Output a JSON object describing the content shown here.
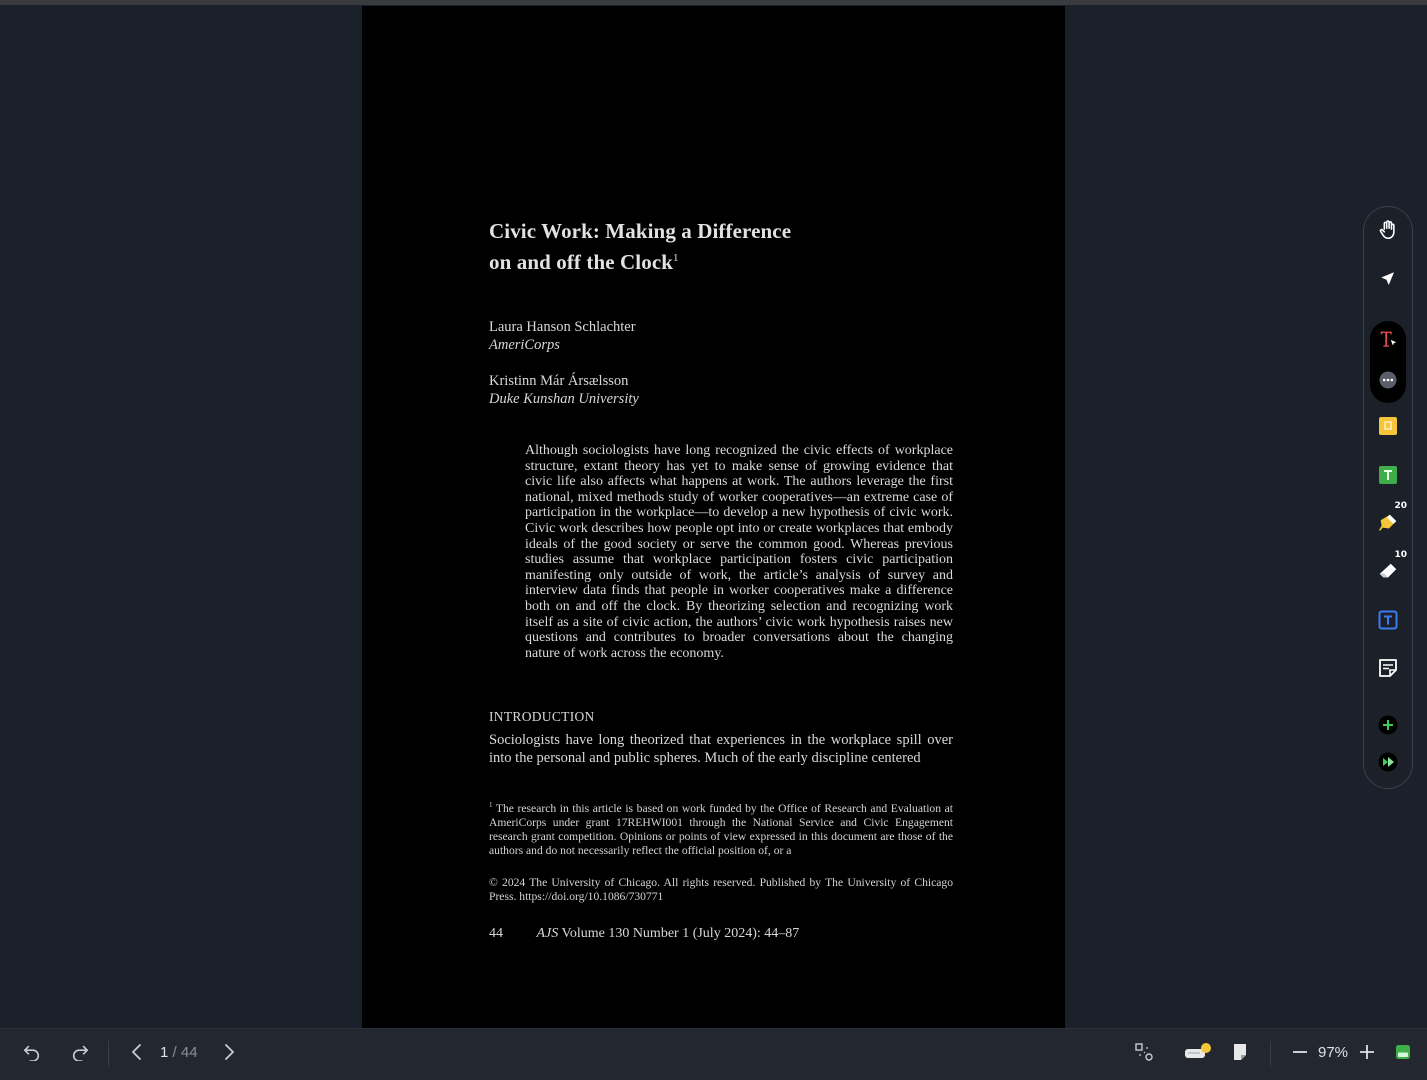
{
  "document": {
    "title_line1": "Civic Work: Making a Difference",
    "title_line2": "on and off the Clock",
    "title_footnote_mark": "1",
    "authors": [
      {
        "name": "Laura Hanson Schlachter",
        "affiliation": "AmeriCorps"
      },
      {
        "name": "Kristinn Már Ársælsson",
        "affiliation": "Duke Kunshan University"
      }
    ],
    "abstract": "Although sociologists have long recognized the civic effects of workplace structure, extant theory has yet to make sense of growing evidence that civic life also affects what happens at work. The authors leverage the first national, mixed methods study of worker cooperatives—an extreme case of participation in the workplace—to develop a new hypothesis of civic work. Civic work describes how people opt into or create workplaces that embody ideals of the good society or serve the common good. Whereas previous studies assume that workplace participation fosters civic participation manifesting only outside of work, the article’s analysis of survey and interview data finds that people in worker cooperatives make a difference both on and off the clock. By theorizing selection and recognizing work itself as a site of civic action, the authors’ civic work hypothesis raises new questions and contributes to broader conversations about the changing nature of work across the economy.",
    "section_heading": "INTRODUCTION",
    "intro_text": "Sociologists have long theorized that experiences in the workplace spill over into the personal and public spheres. Much of the early discipline centered",
    "footnote_mark": "1",
    "footnote_text": "The research in this article is based on work funded by the Office of Research and Evaluation at AmeriCorps under grant 17REHWI001 through the National Service and Civic Engagement research grant competition. Opinions or points of view expressed in this document are those of the authors and do not necessarily reflect the official position of, or a",
    "copyright": "© 2024 The University of Chicago. All rights reserved. Published by The University of Chicago Press. https://doi.org/10.1086/730771",
    "page_number": "44",
    "journal_abbrev": "AJS",
    "journal_citation": "Volume 130 Number 1 (July 2024): 44–87"
  },
  "toolbar": {
    "tools": [
      {
        "name": "hand-tool",
        "icon": "hand-icon"
      },
      {
        "name": "select-tool",
        "icon": "pointer-icon"
      },
      {
        "name": "text-select-tool",
        "icon": "text-cursor-icon"
      },
      {
        "name": "more-tool",
        "icon": "more-icon"
      },
      {
        "name": "sticky-note-tool",
        "icon": "sticky-note-icon"
      },
      {
        "name": "text-highlight-tool",
        "icon": "text-box-icon"
      },
      {
        "name": "highlighter-tool",
        "icon": "highlighter-icon"
      },
      {
        "name": "eraser-tool",
        "icon": "eraser-icon"
      },
      {
        "name": "textbox-tool",
        "icon": "textbox-icon"
      },
      {
        "name": "note-tool",
        "icon": "note-icon"
      },
      {
        "name": "add-tool",
        "icon": "plus-icon"
      },
      {
        "name": "ai-tool",
        "icon": "ai-icon"
      }
    ],
    "highlighter_size": "20",
    "eraser_size": "10"
  },
  "colors": {
    "sticky": "#f5c53a",
    "green_text": "#3fae4a",
    "highlighter": "#f5c53a",
    "blue_text": "#3b7cf0",
    "text_tool_red": "#e5484d"
  },
  "navigation": {
    "current_page": "1",
    "separator": "/",
    "total_pages": "44",
    "zoom": "97%"
  }
}
